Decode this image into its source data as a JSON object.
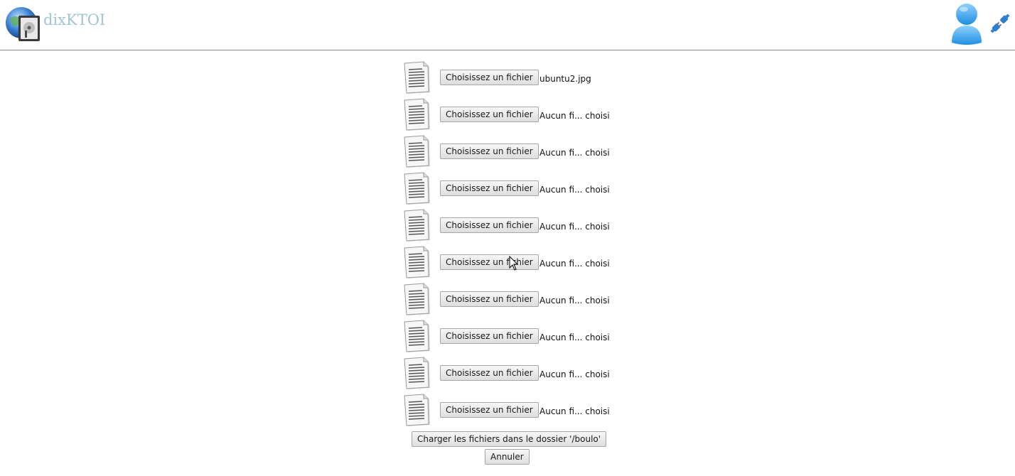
{
  "header": {
    "brand": "dixKTOI",
    "logo_icon": "disk-globe-logo-icon",
    "user_icon": "user-icon",
    "logout_icon": "plug-disconnect-icon"
  },
  "upload": {
    "choose_label": "Choisissez un fichier",
    "files": [
      {
        "status": "ubuntu2.jpg"
      },
      {
        "status": "Aucun fi... choisi"
      },
      {
        "status": "Aucun fi... choisi"
      },
      {
        "status": "Aucun fi... choisi"
      },
      {
        "status": "Aucun fi... choisi"
      },
      {
        "status": "Aucun fi... choisi"
      },
      {
        "status": "Aucun fi... choisi"
      },
      {
        "status": "Aucun fi... choisi"
      },
      {
        "status": "Aucun fi... choisi"
      },
      {
        "status": "Aucun fi... choisi"
      }
    ],
    "submit_label": "Charger les fichiers dans le dossier '/boulo'",
    "cancel_label": "Annuler"
  },
  "colors": {
    "brand_text": "#9fc4d2",
    "user_icon": "#3fa9e8",
    "header_rule": "#8a8a8a"
  }
}
